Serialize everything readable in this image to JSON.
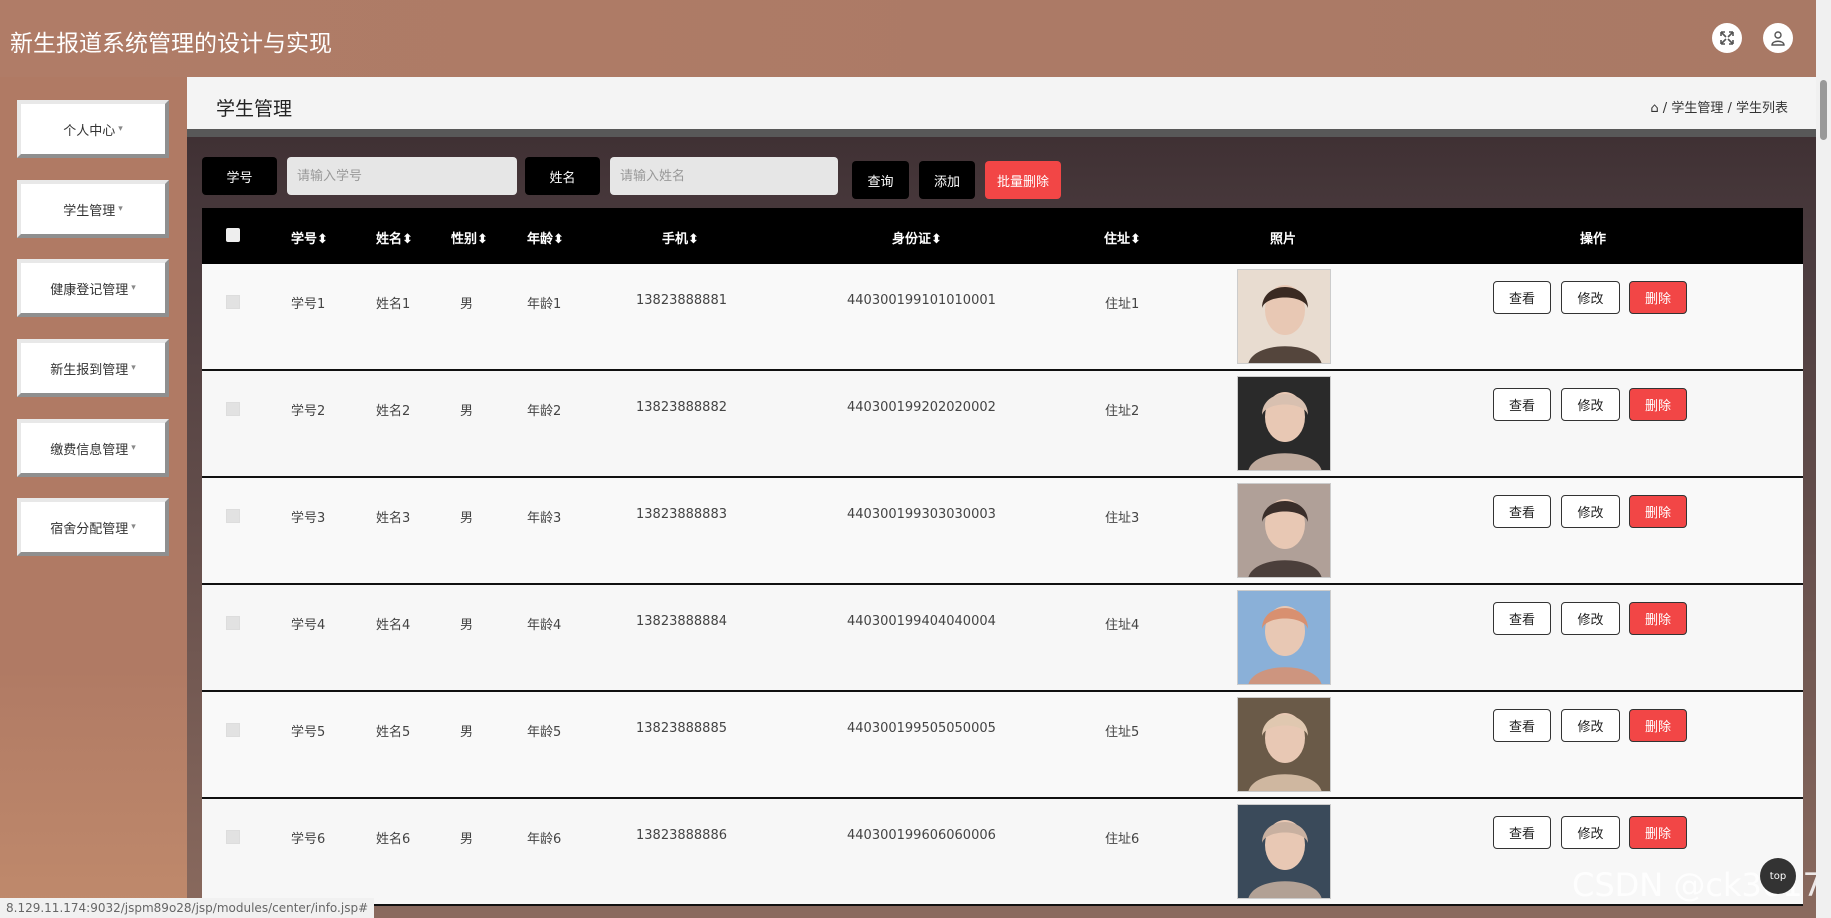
{
  "header": {
    "title": "新生报道系统管理的设计与实现",
    "fullscreen_icon": "expand-icon",
    "user_icon": "user-icon"
  },
  "sidebar": {
    "items": [
      {
        "label": "个人中心"
      },
      {
        "label": "学生管理"
      },
      {
        "label": "健康登记管理"
      },
      {
        "label": "新生报到管理"
      },
      {
        "label": "缴费信息管理"
      },
      {
        "label": "宿舍分配管理"
      }
    ]
  },
  "page": {
    "title": "学生管理",
    "breadcrumb": [
      "学生管理",
      "学生列表"
    ]
  },
  "search": {
    "student_no_label": "学号",
    "student_no_placeholder": "请输入学号",
    "name_label": "姓名",
    "name_placeholder": "请输入姓名",
    "query_label": "查询",
    "add_label": "添加",
    "batch_delete_label": "批量删除"
  },
  "table": {
    "headers": [
      "学号",
      "姓名",
      "性别",
      "年龄",
      "手机",
      "身份证",
      "住址",
      "照片",
      "操作"
    ],
    "rows": [
      {
        "no": "学号1",
        "name": "姓名1",
        "gender": "男",
        "age": "年龄1",
        "phone": "13823888881",
        "idcard": "440300199101010001",
        "address": "住址1"
      },
      {
        "no": "学号2",
        "name": "姓名2",
        "gender": "男",
        "age": "年龄2",
        "phone": "13823888882",
        "idcard": "440300199202020002",
        "address": "住址2"
      },
      {
        "no": "学号3",
        "name": "姓名3",
        "gender": "男",
        "age": "年龄3",
        "phone": "13823888883",
        "idcard": "440300199303030003",
        "address": "住址3"
      },
      {
        "no": "学号4",
        "name": "姓名4",
        "gender": "男",
        "age": "年龄4",
        "phone": "13823888884",
        "idcard": "440300199404040004",
        "address": "住址4"
      },
      {
        "no": "学号5",
        "name": "姓名5",
        "gender": "男",
        "age": "年龄5",
        "phone": "13823888885",
        "idcard": "440300199505050005",
        "address": "住址5"
      },
      {
        "no": "学号6",
        "name": "姓名6",
        "gender": "男",
        "age": "年龄6",
        "phone": "13823888886",
        "idcard": "440300199606060006",
        "address": "住址6"
      }
    ],
    "actions": {
      "view": "查看",
      "edit": "修改",
      "delete": "删除"
    }
  },
  "status_bar": {
    "url": "8.129.11.174:9032/jspm89o28/jsp/modules/center/info.jsp#"
  },
  "watermark": "CSDN @ck3017",
  "colors": {
    "header_bg": "#b07c67",
    "delete_red": "#f24646",
    "table_header": "#000000"
  }
}
